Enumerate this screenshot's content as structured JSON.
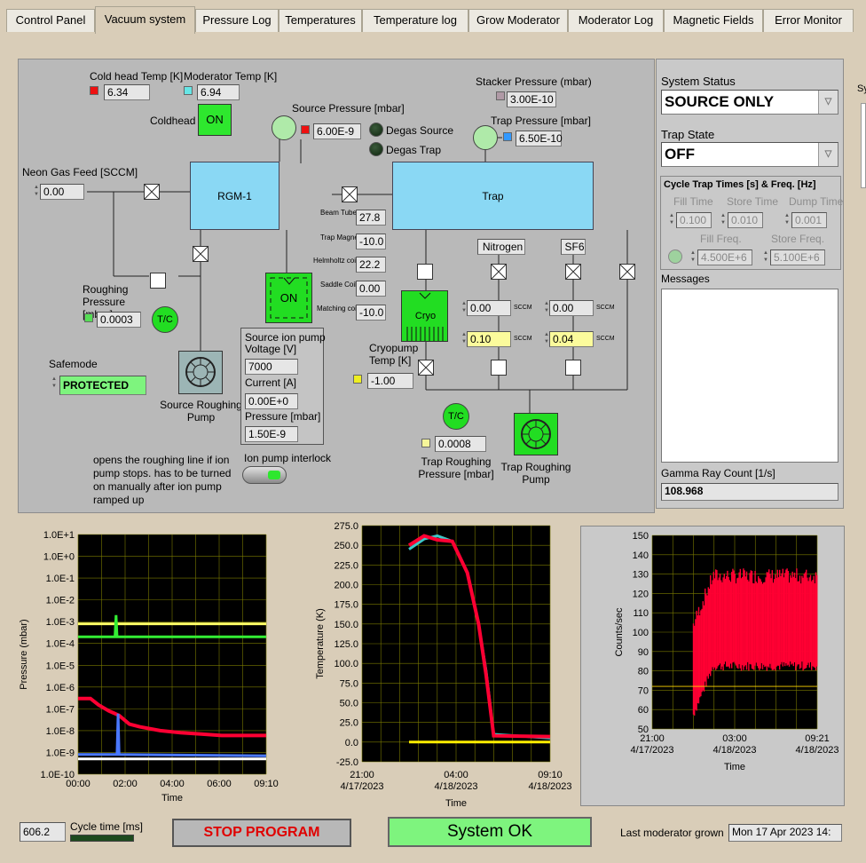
{
  "tabs": [
    "Control Panel",
    "Vacuum system",
    "Pressure Log",
    "Temperatures",
    "Temperature log",
    "Grow Moderator",
    "Moderator Log",
    "Magnetic Fields",
    "Error Monitor"
  ],
  "colors": {
    "status_ok": "#7ef47e",
    "led_on": "#2ee72e",
    "plot_red": "#ff0033",
    "plot_yellow": "#ffff66",
    "plot_green": "#33ee33",
    "plot_blue": "#4a78ff",
    "plot_cyan": "#3cc8c8"
  },
  "vacuum": {
    "cold_head_temp_label": "Cold head Temp [K]",
    "cold_head_temp": "6.34",
    "moderator_temp_label": "Moderator Temp [K]",
    "moderator_temp": "6.94",
    "coldhead_label": "Coldhead",
    "coldhead_state": "ON",
    "source_pressure_label": "Source Pressure [mbar]",
    "source_pressure": "6.00E-9",
    "degas_source_label": "Degas Source",
    "degas_trap_label": "Degas Trap",
    "stacker_pressure_label": "Stacker Pressure (mbar)",
    "stacker_pressure": "3.00E-10",
    "trap_pressure_label": "Trap Pressure [mbar]",
    "trap_pressure": "6.50E-10",
    "neon_feed_label": "Neon Gas Feed [SCCM]",
    "neon_feed": "0.00",
    "rgm_label": "RGM-1",
    "trap_label": "Trap",
    "beam_tube_label": "Beam Tube [C]",
    "beam_tube": "27.8",
    "trap_magnet_label": "Trap Magnet [C]",
    "trap_magnet": "-10.0",
    "helmholtz_label": "Helmholtz coils [C]",
    "helmholtz": "22.2",
    "saddle_label": "Saddle Coils [C]",
    "saddle": "0.00",
    "matching_label": "Matching coil [C]",
    "matching": "-10.0",
    "nitrogen_label": "Nitrogen",
    "sf6_label": "SF6",
    "n2_flow": "0.00",
    "n2_set": "0.10",
    "sf6_flow": "0.00",
    "sf6_set": "0.04",
    "sccm": "SCCM",
    "roughing_pressure_label": "Roughing Pressure [mbar]",
    "roughing_pressure": "0.0003",
    "tc_label": "T/C",
    "ion_pump_state": "ON",
    "cryo_label": "Cryo",
    "cryopump_temp_label": "Cryopump Temp [K]",
    "cryopump_temp": "-1.00",
    "safemode_label": "Safemode",
    "safemode_value": "PROTECTED",
    "source_roughing_pump_label": "Source Roughing Pump",
    "ion_pump_title": "Source ion pump",
    "voltage_label": "Voltage [V]",
    "voltage": "7000",
    "current_label": "Current [A]",
    "current": "0.00E+0",
    "ion_pressure_label": "Pressure [mbar]",
    "ion_pressure": "1.50E-9",
    "trap_roughing_pressure_label": "Trap Roughing Pressure [mbar]",
    "trap_roughing_pressure": "0.0008",
    "trap_roughing_pump_label": "Trap Roughing Pump",
    "note": "opens the roughing line if ion pump stops. has to be turned on manually after ion pump ramped up",
    "interlock_label": "Ion pump interlock"
  },
  "side": {
    "system_status_label": "System Status",
    "system_status": "SOURCE ONLY",
    "trap_state_label": "Trap State",
    "trap_state": "OFF",
    "cycle_title": "Cycle Trap Times [s] & Freq. [Hz]",
    "fill_time_label": "Fill Time",
    "fill_time": "0.100",
    "store_time_label": "Store Time",
    "store_time": "0.010",
    "dump_time_label": "Dump Time",
    "dump_time": "0.001",
    "fill_freq_label": "Fill Freq.",
    "fill_freq": "4.500E+6",
    "store_freq_label": "Store Freq.",
    "store_freq": "5.100E+6",
    "messages_label": "Messages",
    "messages": "",
    "gamma_label": "Gamma Ray Count [1/s]",
    "gamma": "108.968",
    "cut_label": "Sy"
  },
  "bottom": {
    "cycle_value": "606.2",
    "cycle_label": "Cycle time [ms]",
    "stop_label": "STOP PROGRAM",
    "system_ok": "System OK",
    "last_grown_label": "Last moderator grown",
    "last_grown": "Mon 17 Apr 2023 14:"
  },
  "chart_data": [
    {
      "type": "line",
      "ylabel": "Pressure (mbar)",
      "xlabel": "Time",
      "yscale": "log",
      "yticks": [
        "1.0E+1",
        "1.0E+0",
        "1.0E-1",
        "1.0E-2",
        "1.0E-3",
        "1.0E-4",
        "1.0E-5",
        "1.0E-6",
        "1.0E-7",
        "1.0E-8",
        "1.0E-9",
        "1.0E-10"
      ],
      "xticks": [
        "00:00",
        "02:00",
        "04:00",
        "06:00",
        "09:10"
      ],
      "ylim": [
        1e-10,
        10
      ],
      "series": [
        {
          "color": "#ffff66",
          "x": [
            0,
            9.17
          ],
          "y": [
            0.0008,
            0.0008
          ]
        },
        {
          "color": "#33ee33",
          "x": [
            0,
            1.8,
            1.85,
            1.9,
            9.17
          ],
          "y": [
            0.0002,
            0.0002,
            0.002,
            0.0002,
            0.0002
          ]
        },
        {
          "color": "#ff0033",
          "x": [
            0,
            0.6,
            1.0,
            1.5,
            2.0,
            2.5,
            3,
            4,
            5,
            6,
            7,
            8,
            9.17
          ],
          "y": [
            3e-07,
            3e-07,
            1.5e-07,
            8e-08,
            5e-08,
            2e-08,
            1.5e-08,
            1e-08,
            8e-09,
            7e-09,
            6e-09,
            6e-09,
            6e-09
          ]
        },
        {
          "color": "#4a78ff",
          "x": [
            0,
            1.9,
            1.95,
            2.0,
            9.17
          ],
          "y": [
            8e-10,
            8e-10,
            6e-08,
            8e-10,
            7e-10
          ]
        },
        {
          "color": "#ffffff",
          "x": [
            0,
            9.17
          ],
          "y": [
            5e-10,
            5e-10
          ]
        }
      ]
    },
    {
      "type": "line",
      "ylabel": "Temperature (K)",
      "xlabel": "Time",
      "yticks": [
        "275.0",
        "250.0",
        "225.0",
        "200.0",
        "175.0",
        "150.0",
        "125.0",
        "100.0",
        "75.0",
        "50.0",
        "25.0",
        "0.0",
        "-25.0"
      ],
      "xticks": [
        "21:00\n4/17/2023",
        "04:00\n4/18/2023",
        "09:10\n4/18/2023"
      ],
      "ylim": [
        -25,
        275
      ],
      "series": [
        {
          "color": "#3cc8c8",
          "x": [
            0.25,
            0.33,
            0.4,
            0.48,
            0.56,
            0.62,
            0.66,
            0.7,
            1.0
          ],
          "y": [
            245,
            258,
            262,
            255,
            215,
            150,
            90,
            10,
            5
          ]
        },
        {
          "color": "#ff0033",
          "x": [
            0.25,
            0.33,
            0.4,
            0.48,
            0.56,
            0.62,
            0.66,
            0.7,
            1.0
          ],
          "y": [
            250,
            262,
            257,
            255,
            215,
            150,
            85,
            8,
            7
          ]
        },
        {
          "color": "#ffee00",
          "x": [
            0.25,
            1.0
          ],
          "y": [
            0,
            0
          ]
        }
      ]
    },
    {
      "type": "scatter",
      "ylabel": "Counts/sec",
      "xlabel": "Time",
      "yticks": [
        "150",
        "140",
        "130",
        "120",
        "110",
        "100",
        "90",
        "80",
        "70",
        "60",
        "50"
      ],
      "xticks": [
        "21:00\n4/17/2023",
        "03:00\n4/18/2023",
        "09:21\n4/18/2023"
      ],
      "ylim": [
        50,
        150
      ],
      "series": [
        {
          "color": "#ff0033",
          "x_start": 0.25,
          "x_end": 1.0,
          "y_low": [
            55,
            80
          ],
          "y_high": [
            100,
            125
          ],
          "cursor_y": 72
        }
      ]
    }
  ]
}
